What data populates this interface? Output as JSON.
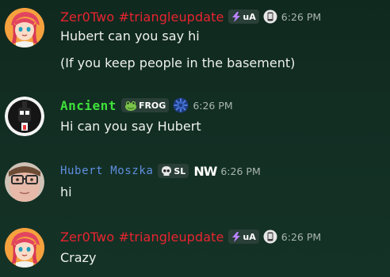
{
  "messages": [
    {
      "author": "Zer0Two #triangleupdate",
      "tag": "uA",
      "timestamp": "6:26 PM",
      "lines": [
        "Hubert can you say hi",
        "(If you keep people in the basement)"
      ],
      "avatar": "anime-girl-avatar",
      "color": "#e8242f"
    },
    {
      "author": "Ancient",
      "tag": "FROG",
      "timestamp": "6:26 PM",
      "lines": [
        "Hi can you say Hubert"
      ],
      "avatar": "dark-robot-avatar",
      "color": "#3fe03a"
    },
    {
      "author": "Hubert Moszka",
      "tag": "SL",
      "badge_text": "NW",
      "timestamp": "6:26 PM",
      "lines": [
        "hi"
      ],
      "avatar": "face-with-glasses-avatar",
      "color": "#5f8ee0"
    },
    {
      "author": "Zer0Two #triangleupdate",
      "tag": "uA",
      "timestamp": "6:26 PM",
      "lines": [
        "Crazy"
      ],
      "avatar": "anime-girl-avatar",
      "color": "#e8242f"
    }
  ],
  "icons": {
    "tag_zero": "lightning-icon",
    "tag_ancient": "frog-icon",
    "tag_hubert": "skull-icon",
    "badge_zero": "phone-icon",
    "badge_ancient": "gear-icon"
  }
}
